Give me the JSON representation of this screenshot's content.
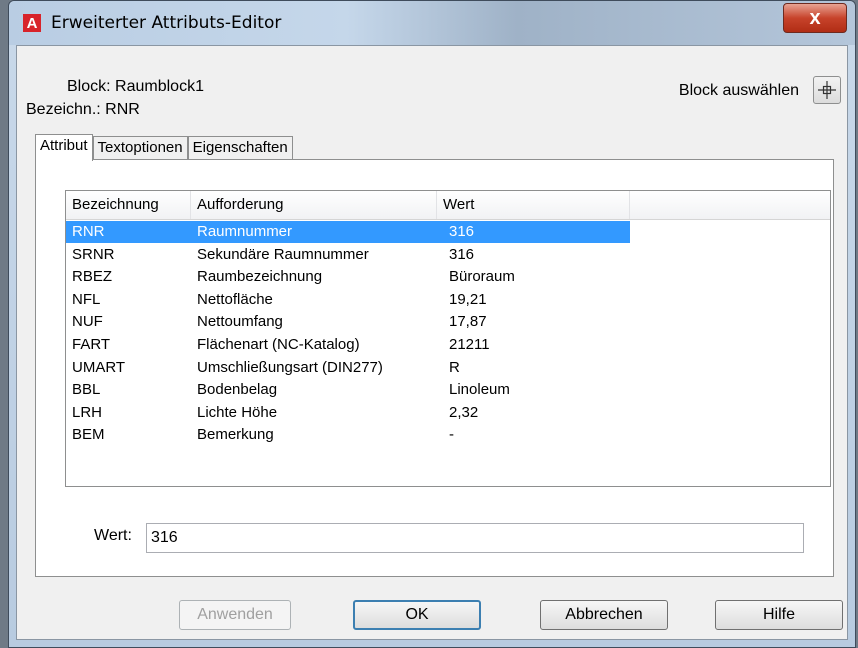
{
  "window": {
    "title": "Erweiterter Attributs-Editor",
    "close_symbol": "x",
    "app_icon_letter": "A"
  },
  "info": {
    "block_label": "Block:",
    "block_value": "Raumblock1",
    "tag_label": "Bezeichn.:",
    "tag_value": "RNR"
  },
  "block_select": {
    "label": "Block auswählen",
    "pick_icon": "crosshair-pick-icon"
  },
  "tabs": [
    {
      "label": "Attribut",
      "active": true
    },
    {
      "label": "Textoptionen",
      "active": false
    },
    {
      "label": "Eigenschaften",
      "active": false
    }
  ],
  "table": {
    "columns": [
      "Bezeichnung",
      "Aufforderung",
      "Wert"
    ],
    "rows": [
      {
        "tag": "RNR",
        "prompt": "Raumnummer",
        "value": "316",
        "selected": true
      },
      {
        "tag": "SRNR",
        "prompt": "Sekundäre Raumnummer",
        "value": "316"
      },
      {
        "tag": "RBEZ",
        "prompt": "Raumbezeichnung",
        "value": "Büroraum"
      },
      {
        "tag": "NFL",
        "prompt": "Nettofläche",
        "value": "19,21"
      },
      {
        "tag": "NUF",
        "prompt": "Nettoumfang",
        "value": "17,87"
      },
      {
        "tag": "FART",
        "prompt": "Flächenart (NC-Katalog)",
        "value": "21211"
      },
      {
        "tag": "UMART",
        "prompt": "Umschließungsart (DIN277)",
        "value": "R"
      },
      {
        "tag": "BBL",
        "prompt": "Bodenbelag",
        "value": "Linoleum"
      },
      {
        "tag": "LRH",
        "prompt": "Lichte Höhe",
        "value": "2,32"
      },
      {
        "tag": "BEM",
        "prompt": "Bemerkung",
        "value": "-"
      }
    ]
  },
  "value_field": {
    "label": "Wert:",
    "value": "316"
  },
  "buttons": {
    "apply": "Anwenden",
    "ok": "OK",
    "cancel": "Abbrechen",
    "help": "Hilfe"
  },
  "colors": {
    "selection": "#3399ff",
    "close_button": "#c7432b",
    "app_icon": "#d8232a"
  }
}
